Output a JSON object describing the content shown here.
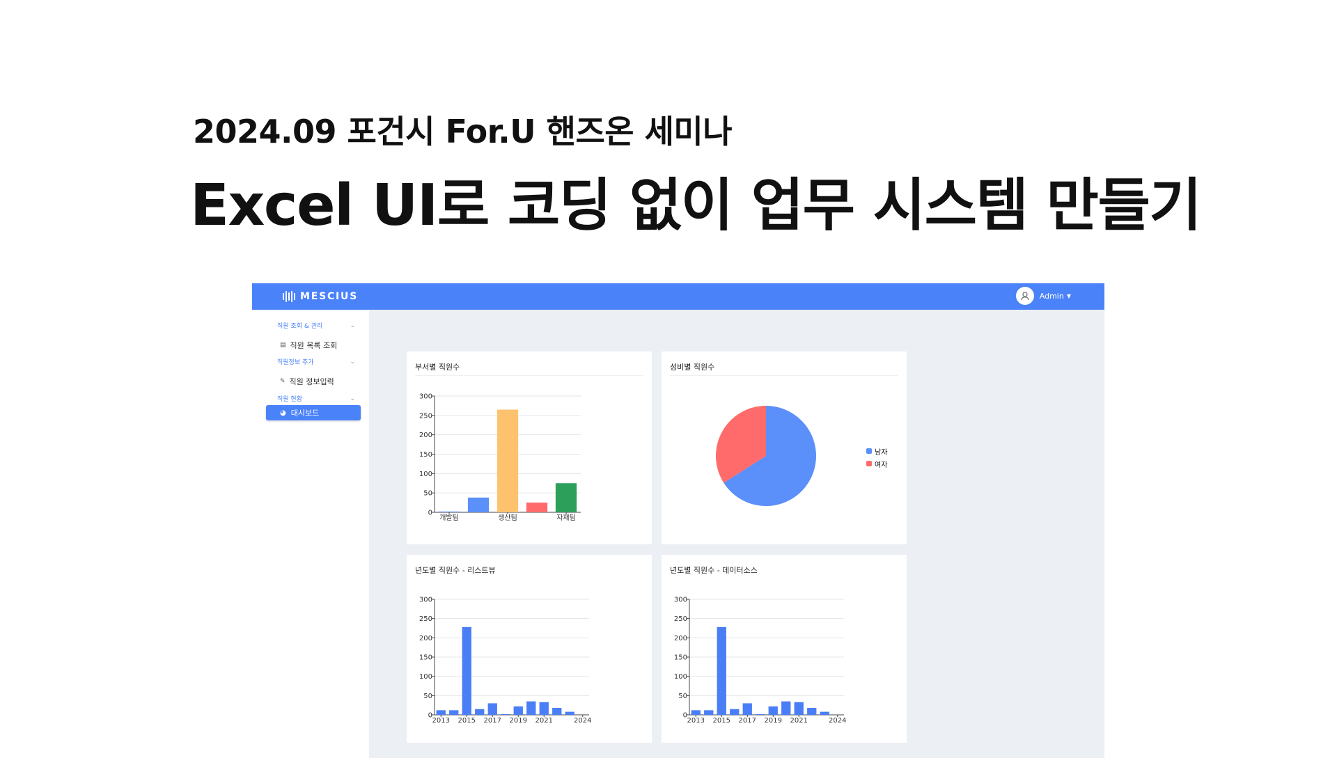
{
  "slide": {
    "subtitle": "2024.09 포건시 For.U 핸즈온 세미나",
    "title": "Excel UI로 코딩 없이 업무 시스템 만들기"
  },
  "header": {
    "logo_text": "MESCIUS",
    "user_name": "Admin",
    "brand_color": "#4a82fa"
  },
  "sidebar": {
    "sections": [
      {
        "label": "직원 조회 & 관리",
        "items": [
          {
            "label": "직원 목록 조회",
            "icon": "list-icon"
          }
        ]
      },
      {
        "label": "직원정보 추가",
        "items": [
          {
            "label": "직원 정보입력",
            "icon": "edit-icon"
          }
        ]
      },
      {
        "label": "직원 현황",
        "items": [
          {
            "label": "대시보드",
            "icon": "pie-icon",
            "active": true
          }
        ]
      }
    ]
  },
  "chart_data": [
    {
      "type": "bar",
      "title": "부서별 직원수",
      "categories": [
        "개발팀",
        "",
        "생산팀",
        "",
        "자재팀"
      ],
      "values": [
        2,
        38,
        265,
        25,
        75
      ],
      "colors": [
        "#5b8ff9",
        "#5b8ff9",
        "#fdc26e",
        "#ff6b6b",
        "#2ca05a"
      ],
      "ylim": [
        0,
        300
      ],
      "yticks": [
        0,
        50,
        100,
        150,
        200,
        250,
        300
      ],
      "grid": true
    },
    {
      "type": "pie",
      "title": "성비별 직원수",
      "labels": [
        "남자",
        "여자"
      ],
      "values": [
        66,
        34
      ],
      "colors": [
        "#5b8ff9",
        "#ff6b6b"
      ],
      "legend": "right"
    },
    {
      "type": "bar",
      "title": "년도별 직원수 - 리스트뷰",
      "categories": [
        "2013",
        "2014",
        "2015",
        "2016",
        "2017",
        "2018",
        "2019",
        "2020",
        "2021",
        "2022",
        "2023",
        "2024"
      ],
      "xtick_labels": [
        "2013",
        "",
        "2015",
        "",
        "2017",
        "",
        "2019",
        "",
        "2021",
        "",
        "",
        "2024"
      ],
      "values": [
        12,
        12,
        228,
        15,
        30,
        2,
        22,
        35,
        33,
        18,
        8,
        0
      ],
      "color": "#4a7ef7",
      "ylim": [
        0,
        300
      ],
      "yticks": [
        0,
        50,
        100,
        150,
        200,
        250,
        300
      ],
      "grid": true
    },
    {
      "type": "bar",
      "title": "년도별 직원수 - 데이터소스",
      "categories": [
        "2013",
        "2014",
        "2015",
        "2016",
        "2017",
        "2018",
        "2019",
        "2020",
        "2021",
        "2022",
        "2023",
        "2024"
      ],
      "xtick_labels": [
        "2013",
        "",
        "2015",
        "",
        "2017",
        "",
        "2019",
        "",
        "2021",
        "",
        "",
        "2024"
      ],
      "values": [
        12,
        12,
        228,
        15,
        30,
        2,
        22,
        35,
        33,
        18,
        8,
        0
      ],
      "color": "#4a7ef7",
      "ylim": [
        0,
        300
      ],
      "yticks": [
        0,
        50,
        100,
        150,
        200,
        250,
        300
      ],
      "grid": true
    }
  ]
}
